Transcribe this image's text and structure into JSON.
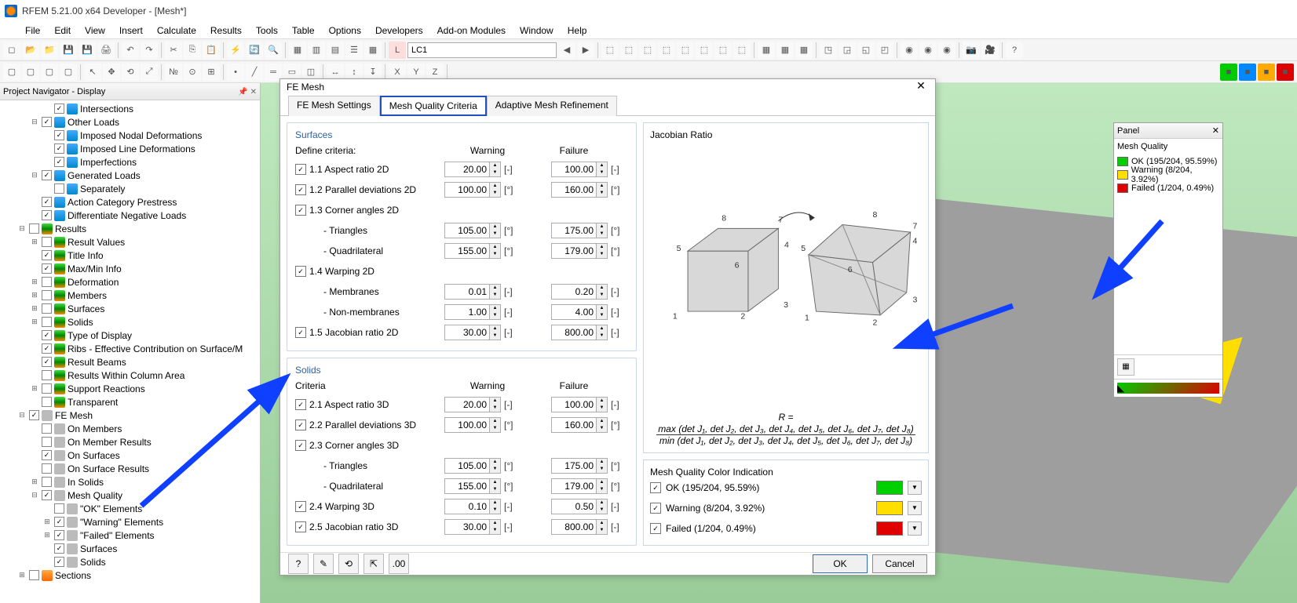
{
  "window": {
    "title": "RFEM 5.21.00 x64 Developer - [Mesh*]"
  },
  "menu": [
    "File",
    "Edit",
    "View",
    "Insert",
    "Calculate",
    "Results",
    "Tools",
    "Table",
    "Options",
    "Developers",
    "Add-on Modules",
    "Window",
    "Help"
  ],
  "toolbar": {
    "lc": "LC1"
  },
  "navigator": {
    "title": "Project Navigator - Display",
    "items": [
      {
        "ind": 3,
        "exp": "",
        "cb": true,
        "ic": "ic-blue",
        "lbl": "Intersections"
      },
      {
        "ind": 2,
        "exp": "−",
        "cb": true,
        "ic": "ic-blue",
        "lbl": "Other Loads"
      },
      {
        "ind": 3,
        "exp": "",
        "cb": true,
        "ic": "ic-blue",
        "lbl": "Imposed Nodal Deformations"
      },
      {
        "ind": 3,
        "exp": "",
        "cb": true,
        "ic": "ic-blue",
        "lbl": "Imposed Line Deformations"
      },
      {
        "ind": 3,
        "exp": "",
        "cb": true,
        "ic": "ic-blue",
        "lbl": "Imperfections"
      },
      {
        "ind": 2,
        "exp": "−",
        "cb": true,
        "ic": "ic-blue",
        "lbl": "Generated Loads"
      },
      {
        "ind": 3,
        "exp": "",
        "cb": false,
        "ic": "ic-blue",
        "lbl": "Separately"
      },
      {
        "ind": 2,
        "exp": "",
        "cb": true,
        "ic": "ic-blue",
        "lbl": "Action Category Prestress"
      },
      {
        "ind": 2,
        "exp": "",
        "cb": true,
        "ic": "ic-blue",
        "lbl": "Differentiate Negative Loads"
      },
      {
        "ind": 1,
        "exp": "−",
        "cb": false,
        "ic": "ic-green",
        "lbl": "Results"
      },
      {
        "ind": 2,
        "exp": "+",
        "cb": false,
        "ic": "ic-green",
        "lbl": "Result Values"
      },
      {
        "ind": 2,
        "exp": "",
        "cb": true,
        "ic": "ic-green",
        "lbl": "Title Info"
      },
      {
        "ind": 2,
        "exp": "",
        "cb": true,
        "ic": "ic-green",
        "lbl": "Max/Min Info"
      },
      {
        "ind": 2,
        "exp": "+",
        "cb": false,
        "ic": "ic-green",
        "lbl": "Deformation"
      },
      {
        "ind": 2,
        "exp": "+",
        "cb": false,
        "ic": "ic-green",
        "lbl": "Members"
      },
      {
        "ind": 2,
        "exp": "+",
        "cb": false,
        "ic": "ic-green",
        "lbl": "Surfaces"
      },
      {
        "ind": 2,
        "exp": "+",
        "cb": false,
        "ic": "ic-green",
        "lbl": "Solids"
      },
      {
        "ind": 2,
        "exp": "",
        "cb": true,
        "ic": "ic-green",
        "lbl": "Type of Display"
      },
      {
        "ind": 2,
        "exp": "",
        "cb": true,
        "ic": "ic-green",
        "lbl": "Ribs - Effective Contribution on Surface/M"
      },
      {
        "ind": 2,
        "exp": "",
        "cb": true,
        "ic": "ic-green",
        "lbl": "Result Beams"
      },
      {
        "ind": 2,
        "exp": "",
        "cb": false,
        "ic": "ic-green",
        "lbl": "Results Within Column Area"
      },
      {
        "ind": 2,
        "exp": "+",
        "cb": false,
        "ic": "ic-green",
        "lbl": "Support Reactions"
      },
      {
        "ind": 2,
        "exp": "",
        "cb": false,
        "ic": "ic-green",
        "lbl": "Transparent"
      },
      {
        "ind": 1,
        "exp": "−",
        "cb": true,
        "ic": "ic-grey",
        "lbl": "FE Mesh"
      },
      {
        "ind": 2,
        "exp": "",
        "cb": false,
        "ic": "ic-grey",
        "lbl": "On Members"
      },
      {
        "ind": 2,
        "exp": "",
        "cb": false,
        "ic": "ic-grey",
        "lbl": "On Member Results"
      },
      {
        "ind": 2,
        "exp": "",
        "cb": true,
        "ic": "ic-grey",
        "lbl": "On Surfaces"
      },
      {
        "ind": 2,
        "exp": "",
        "cb": false,
        "ic": "ic-grey",
        "lbl": "On Surface Results"
      },
      {
        "ind": 2,
        "exp": "+",
        "cb": false,
        "ic": "ic-grey",
        "lbl": "In Solids"
      },
      {
        "ind": 2,
        "exp": "−",
        "cb": true,
        "ic": "ic-grey",
        "lbl": "Mesh Quality"
      },
      {
        "ind": 3,
        "exp": "",
        "cb": false,
        "ic": "ic-grey",
        "lbl": "\"OK\" Elements"
      },
      {
        "ind": 3,
        "exp": "+",
        "cb": true,
        "ic": "ic-grey",
        "lbl": "\"Warning\" Elements"
      },
      {
        "ind": 3,
        "exp": "+",
        "cb": true,
        "ic": "ic-grey",
        "lbl": "\"Failed\" Elements"
      },
      {
        "ind": 3,
        "exp": "",
        "cb": true,
        "ic": "ic-grey",
        "lbl": "Surfaces"
      },
      {
        "ind": 3,
        "exp": "",
        "cb": true,
        "ic": "ic-grey",
        "lbl": "Solids"
      },
      {
        "ind": 1,
        "exp": "+",
        "cb": false,
        "ic": "ic-orange",
        "lbl": "Sections"
      }
    ]
  },
  "dialog": {
    "title": "FE Mesh",
    "tabs": [
      "FE Mesh Settings",
      "Mesh Quality Criteria",
      "Adaptive Mesh Refinement"
    ],
    "active_tab": 1,
    "surfaces": {
      "title": "Surfaces",
      "head": {
        "c1": "Define criteria:",
        "c2": "Warning",
        "c3": "Failure"
      },
      "rows": [
        {
          "chk": true,
          "name": "1.1 Aspect ratio 2D",
          "w": "20.00",
          "f": "100.00",
          "u": "[-]"
        },
        {
          "chk": true,
          "name": "1.2 Parallel deviations 2D",
          "w": "100.00",
          "f": "160.00",
          "u": "[°]"
        },
        {
          "chk": true,
          "name": "1.3 Corner angles 2D"
        },
        {
          "sub": "- Triangles",
          "w": "105.00",
          "f": "175.00",
          "u": "[°]"
        },
        {
          "sub": "- Quadrilateral",
          "w": "155.00",
          "f": "179.00",
          "u": "[°]"
        },
        {
          "chk": true,
          "name": "1.4 Warping 2D"
        },
        {
          "sub": "- Membranes",
          "w": "0.01",
          "f": "0.20",
          "u": "[-]"
        },
        {
          "sub": "- Non-membranes",
          "w": "1.00",
          "f": "4.00",
          "u": "[-]"
        },
        {
          "chk": true,
          "name": "1.5 Jacobian ratio 2D",
          "w": "30.00",
          "f": "800.00",
          "u": "[-]"
        }
      ]
    },
    "solids": {
      "title": "Solids",
      "head": {
        "c1": "Criteria",
        "c2": "Warning",
        "c3": "Failure"
      },
      "rows": [
        {
          "chk": true,
          "name": "2.1 Aspect ratio 3D",
          "w": "20.00",
          "f": "100.00",
          "u": "[-]"
        },
        {
          "chk": true,
          "name": "2.2 Parallel deviations 3D",
          "w": "100.00",
          "f": "160.00",
          "u": "[°]"
        },
        {
          "chk": true,
          "name": "2.3 Corner angles 3D"
        },
        {
          "sub": "- Triangles",
          "w": "105.00",
          "f": "175.00",
          "u": "[°]"
        },
        {
          "sub": "- Quadrilateral",
          "w": "155.00",
          "f": "179.00",
          "u": "[°]"
        },
        {
          "chk": true,
          "name": "2.4 Warping 3D",
          "w": "0.10",
          "f": "0.50",
          "u": "[-]"
        },
        {
          "chk": true,
          "name": "2.5 Jacobian ratio 3D",
          "w": "30.00",
          "f": "800.00",
          "u": "[-]"
        }
      ]
    },
    "illus_title": "Jacobian Ratio",
    "formula_top": "max (det J₁, det J₂, det J₃, det J₄, det J₅, det J₆, det J₇, det J₈)",
    "formula_bot": "min (det J₁, det J₂, det J₃, det J₄, det J₅, det J₆, det J₇, det J₈)",
    "R": "R =",
    "color_ind": {
      "title": "Mesh Quality Color Indication",
      "rows": [
        {
          "lbl": "OK (195/204, 95.59%)",
          "color": "#00d000"
        },
        {
          "lbl": "Warning (8/204, 3.92%)",
          "color": "#ffde00"
        },
        {
          "lbl": "Failed (1/204, 0.49%)",
          "color": "#e00000"
        }
      ]
    },
    "ok": "OK",
    "cancel": "Cancel"
  },
  "panel": {
    "title": "Panel",
    "sub": "Mesh Quality",
    "rows": [
      {
        "lbl": "OK (195/204, 95.59%)",
        "color": "#00d000"
      },
      {
        "lbl": "Warning (8/204, 3.92%)",
        "color": "#ffde00"
      },
      {
        "lbl": "Failed (1/204, 0.49%)",
        "color": "#e00000"
      }
    ]
  }
}
